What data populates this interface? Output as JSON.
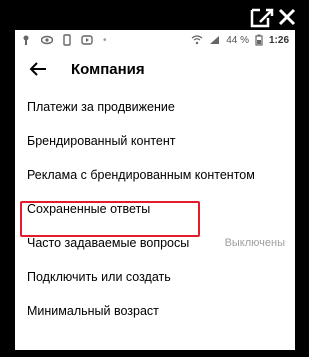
{
  "statusbar": {
    "battery": "44 %",
    "time": "1:26"
  },
  "header": {
    "title": "Компания"
  },
  "list": [
    {
      "label": "Платежи за продвижение"
    },
    {
      "label": "Брендированный контент"
    },
    {
      "label": "Реклама с брендированным контентом"
    },
    {
      "label": "Сохраненные ответы"
    },
    {
      "label": "Часто задаваемые вопросы",
      "value": "Выключены"
    },
    {
      "label": "Подключить или создать"
    },
    {
      "label": "Минимальный возраст"
    }
  ],
  "highlight_color": "#e21b2d"
}
